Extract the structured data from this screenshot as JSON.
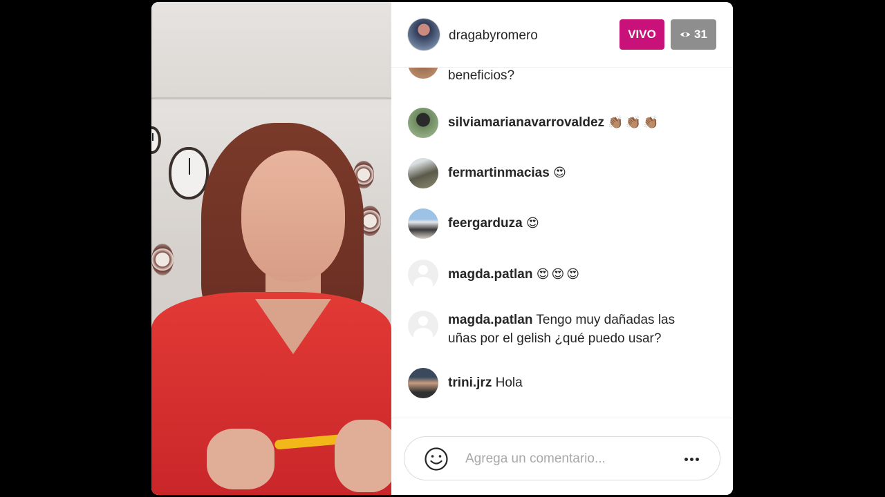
{
  "header": {
    "host_username": "dragabyromero",
    "live_label": "VIVO",
    "viewer_count": "31",
    "viewer_icon": "eye-icon"
  },
  "comments": [
    {
      "user": "",
      "text": "beneficios?",
      "avatar": "photo"
    },
    {
      "user": "silviamarianavarrovaldez",
      "text": "👏🏽👏🏽👏🏽",
      "avatar": "photo"
    },
    {
      "user": "fermartinmacias",
      "text": "😍",
      "avatar": "photo"
    },
    {
      "user": "feergarduza",
      "text": "😍",
      "avatar": "photo"
    },
    {
      "user": "magda.patlan",
      "text": "😍😍😍",
      "avatar": "default-avatar-icon"
    },
    {
      "user": "magda.patlan",
      "text": "Tengo muy dañadas las uñas por el gelish ¿qué puedo usar?",
      "avatar": "default-avatar-icon"
    },
    {
      "user": "trini.jrz",
      "text": "Hola",
      "avatar": "photo"
    }
  ],
  "footer": {
    "comment_placeholder": "Agrega un comentario...",
    "emoji_icon": "smiley-icon",
    "more_icon": "more-options-icon"
  }
}
